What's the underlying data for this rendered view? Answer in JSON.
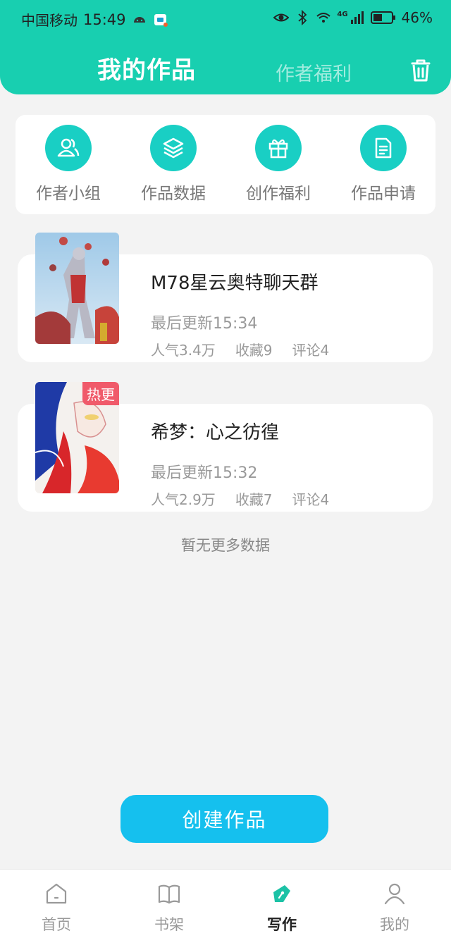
{
  "status": {
    "carrier": "中国移动",
    "time": "15:49",
    "network": "4G",
    "battery": "46%"
  },
  "header": {
    "title": "我的作品",
    "tab_welfare": "作者福利"
  },
  "quick_actions": [
    {
      "label": "作者小组",
      "icon": "users-icon"
    },
    {
      "label": "作品数据",
      "icon": "layers-icon"
    },
    {
      "label": "创作福利",
      "icon": "gift-icon"
    },
    {
      "label": "作品申请",
      "icon": "document-icon"
    }
  ],
  "works": [
    {
      "title": "M78星云奥特聊天群",
      "updated": "最后更新15:34",
      "popularity": "人气3.4万",
      "favorites": "收藏9",
      "comments": "评论4",
      "badge": ""
    },
    {
      "title": "希梦：心之彷徨",
      "updated": "最后更新15:32",
      "popularity": "人气2.9万",
      "favorites": "收藏7",
      "comments": "评论4",
      "badge": "热更"
    }
  ],
  "no_more": "暂无更多数据",
  "create_button": "创建作品",
  "nav": [
    {
      "label": "首页",
      "icon": "home-icon"
    },
    {
      "label": "书架",
      "icon": "book-icon"
    },
    {
      "label": "写作",
      "icon": "pen-icon"
    },
    {
      "label": "我的",
      "icon": "user-icon"
    }
  ],
  "colors": {
    "header_bg": "#18cfb0",
    "accent": "#19cfc4",
    "create_button": "#15c0ee",
    "hot_badge": "#f05a6a"
  }
}
